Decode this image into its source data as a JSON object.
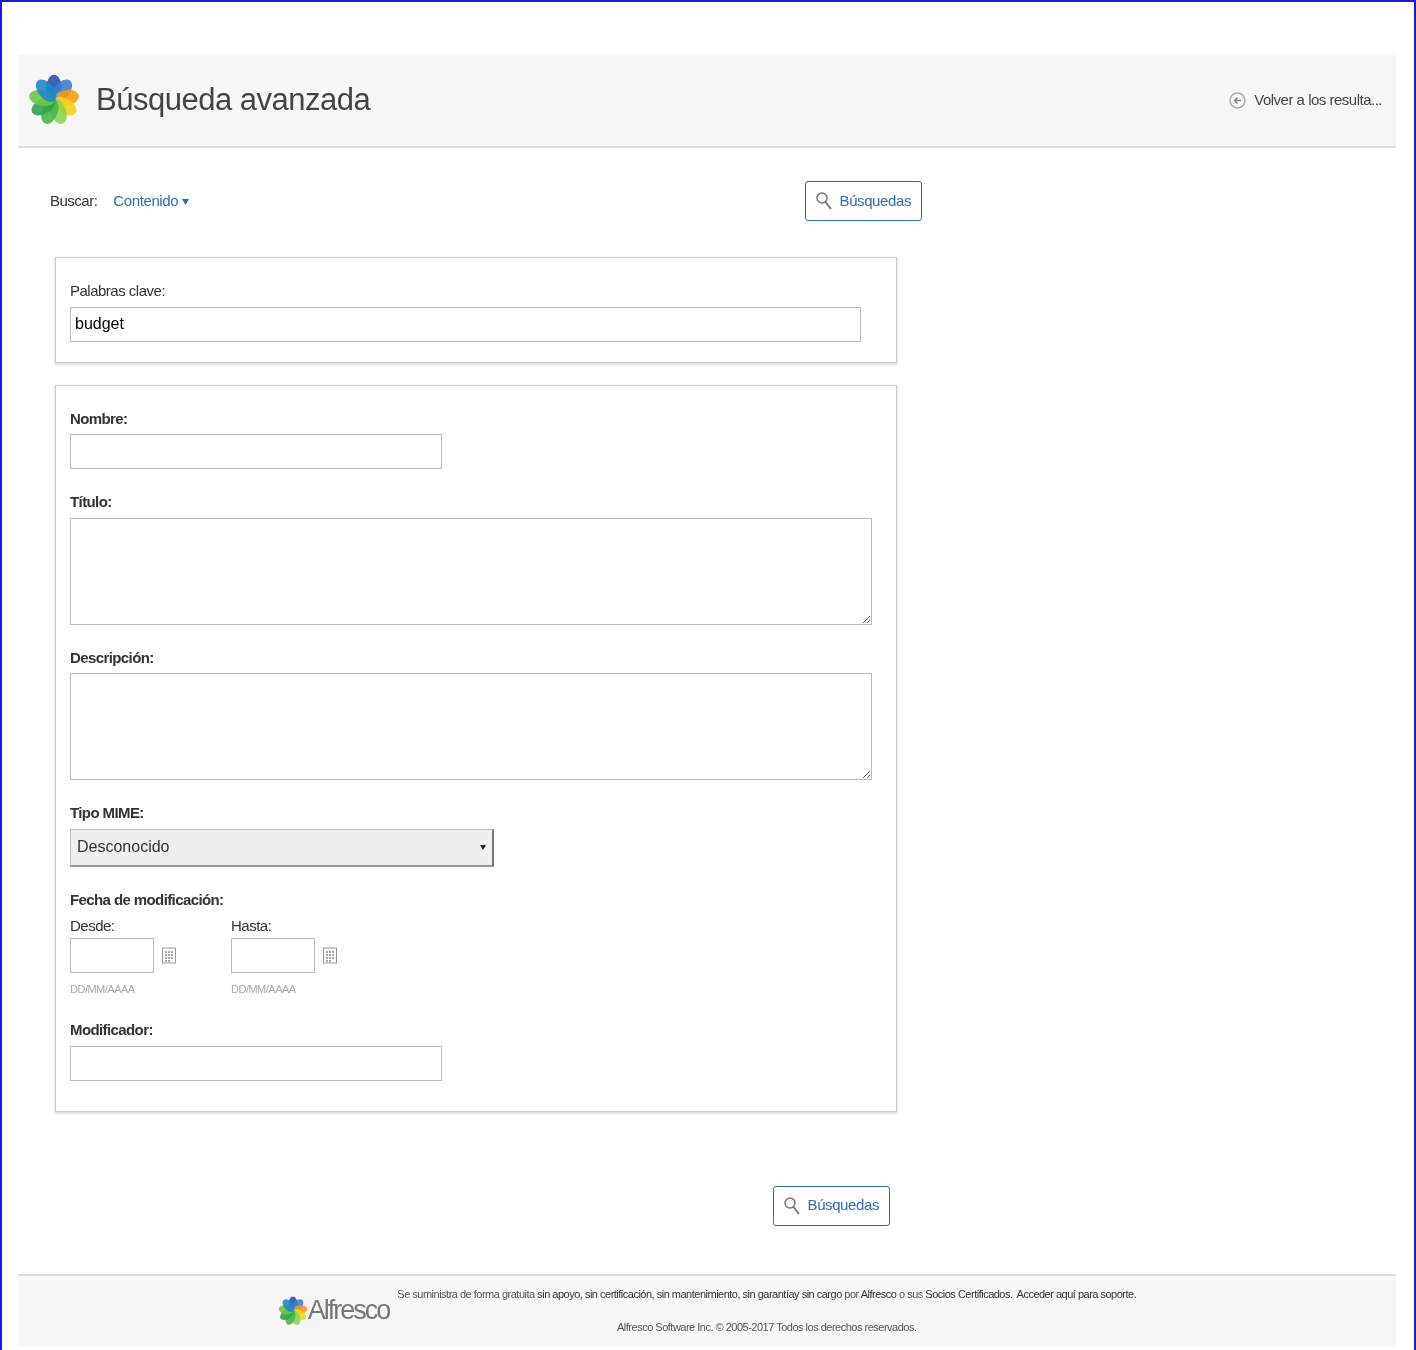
{
  "header": {
    "title": "Búsqueda avanzada",
    "back_link": "Volver a los resulta..."
  },
  "search_bar": {
    "label": "Buscar:",
    "scope": "Contenido",
    "button": "Búsquedas"
  },
  "keywords": {
    "label": "Palabras clave:",
    "value": "budget"
  },
  "fields": [
    {
      "kind": "input",
      "label": "Nombre:"
    },
    {
      "kind": "textarea",
      "label": "Título:"
    },
    {
      "kind": "textarea",
      "label": "Descripción:"
    },
    {
      "kind": "select",
      "label": "Tipo MIME:",
      "value": "Desconocido"
    },
    {
      "kind": "daterange",
      "label": "Fecha de modificación:",
      "ranges": [
        {
          "label": "Desde:",
          "hint": "DD/MM/AAAA"
        },
        {
          "label": "Hasta:",
          "hint": "DD/MM/AAAA"
        }
      ]
    },
    {
      "kind": "input",
      "label": "Modificador:"
    }
  ],
  "bottom_button": "Búsquedas",
  "footer": {
    "logo_text": "Alfresco",
    "notice": "Se suministra de forma gratuita **sin apoyo, sin certificación, sin mantenimiento, sin garantíay sin cargo** por **Alfresco** o sus **Socios Certificados.**",
    "support_link": "Acceder aquí para soporte.",
    "copyright": "Alfresco Software Inc. © 2005-2017 Todos los derechos reservados."
  }
}
